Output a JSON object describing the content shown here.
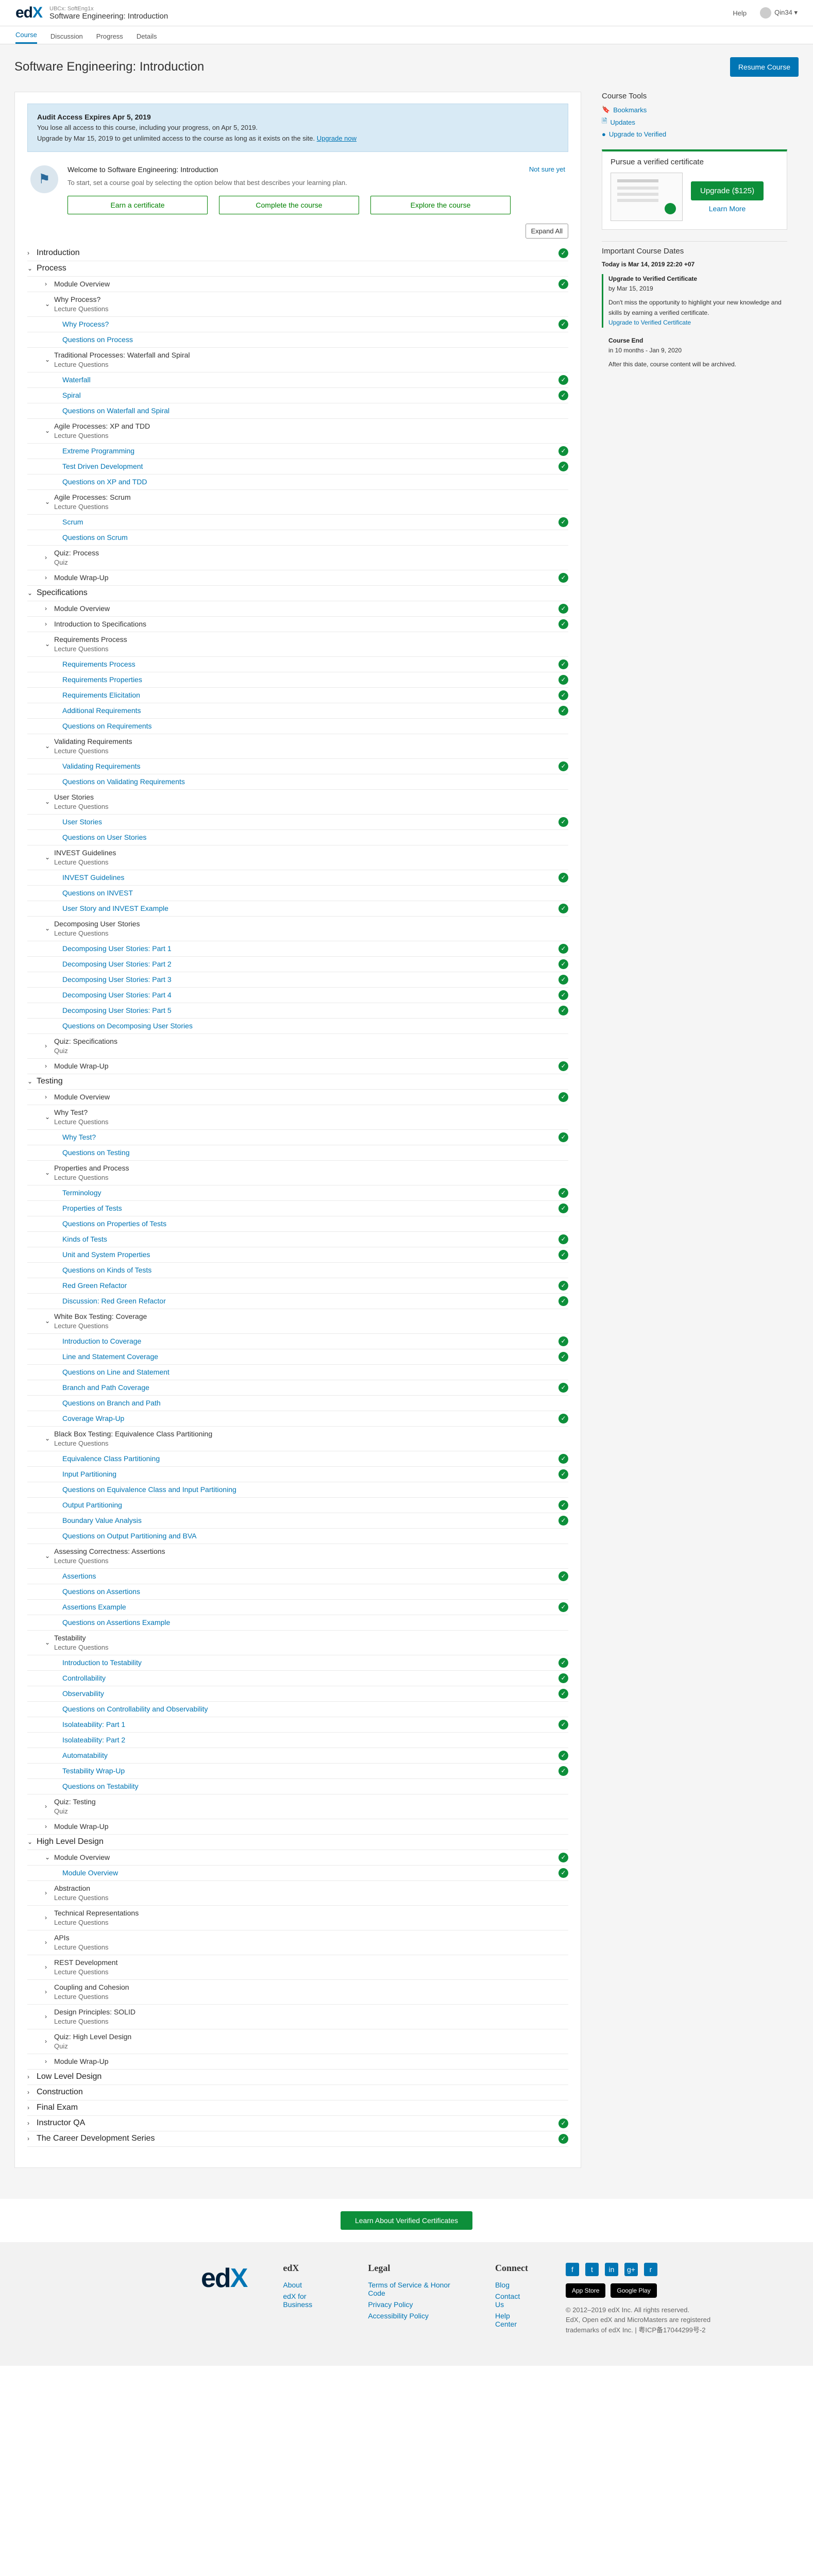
{
  "header": {
    "course_org": "UBCx: SoftEng1x",
    "course_name": "Software Engineering: Introduction",
    "help": "Help",
    "username": "Qin34",
    "user_caret": "▾"
  },
  "tabs": [
    {
      "label": "Course",
      "active": true
    },
    {
      "label": "Discussion",
      "active": false
    },
    {
      "label": "Progress",
      "active": false
    },
    {
      "label": "Details",
      "active": false
    }
  ],
  "page": {
    "title": "Software Engineering: Introduction",
    "resume": "Resume Course"
  },
  "alert": {
    "title": "Audit Access Expires Apr 5, 2019",
    "line1": "You lose all access to this course, including your progress, on Apr 5, 2019.",
    "line2": "Upgrade by Mar 15, 2019 to get unlimited access to the course as long as it exists on the site.",
    "link": "Upgrade now"
  },
  "welcome": {
    "title": "Welcome to Software Engineering: Introduction",
    "not_sure": "Not sure yet",
    "subtitle": "To start, set a course goal by selecting the option below that best describes your learning plan.",
    "goals": [
      "Earn a certificate",
      "Complete the course",
      "Explore the course"
    ]
  },
  "expand_all": "Expand All",
  "outline": [
    {
      "level": 0,
      "label": "Introduction",
      "open": false,
      "done": true
    },
    {
      "level": 0,
      "label": "Process",
      "open": true,
      "done": false
    },
    {
      "level": 1,
      "label": "Module Overview",
      "open": false,
      "done": true
    },
    {
      "level": 1,
      "label": "Why Process?",
      "sub": "Lecture Questions",
      "open": true,
      "done": false
    },
    {
      "level": 2,
      "label": "Why Process?",
      "done": true
    },
    {
      "level": 2,
      "label": "Questions on Process",
      "done": false
    },
    {
      "level": 1,
      "label": "Traditional Processes: Waterfall and Spiral",
      "sub": "Lecture Questions",
      "open": true,
      "done": false
    },
    {
      "level": 2,
      "label": "Waterfall",
      "done": true
    },
    {
      "level": 2,
      "label": "Spiral",
      "done": true
    },
    {
      "level": 2,
      "label": "Questions on Waterfall and Spiral",
      "done": false
    },
    {
      "level": 1,
      "label": "Agile Processes: XP and TDD",
      "sub": "Lecture Questions",
      "open": true,
      "done": false
    },
    {
      "level": 2,
      "label": "Extreme Programming",
      "done": true
    },
    {
      "level": 2,
      "label": "Test Driven Development",
      "done": true
    },
    {
      "level": 2,
      "label": "Questions on XP and TDD",
      "done": false
    },
    {
      "level": 1,
      "label": "Agile Processes: Scrum",
      "sub": "Lecture Questions",
      "open": true,
      "done": false
    },
    {
      "level": 2,
      "label": "Scrum",
      "done": true
    },
    {
      "level": 2,
      "label": "Questions on Scrum",
      "done": false
    },
    {
      "level": 1,
      "label": "Quiz: Process",
      "sub": "Quiz",
      "open": false,
      "done": false
    },
    {
      "level": 1,
      "label": "Module Wrap-Up",
      "open": false,
      "done": true
    },
    {
      "level": 0,
      "label": "Specifications",
      "open": true,
      "done": false
    },
    {
      "level": 1,
      "label": "Module Overview",
      "open": false,
      "done": true
    },
    {
      "level": 1,
      "label": "Introduction to Specifications",
      "open": false,
      "done": true
    },
    {
      "level": 1,
      "label": "Requirements Process",
      "sub": "Lecture Questions",
      "open": true,
      "done": false
    },
    {
      "level": 2,
      "label": "Requirements Process",
      "done": true
    },
    {
      "level": 2,
      "label": "Requirements Properties",
      "done": true
    },
    {
      "level": 2,
      "label": "Requirements Elicitation",
      "done": true
    },
    {
      "level": 2,
      "label": "Additional Requirements",
      "done": true
    },
    {
      "level": 2,
      "label": "Questions on Requirements",
      "done": false
    },
    {
      "level": 1,
      "label": "Validating Requirements",
      "sub": "Lecture Questions",
      "open": true,
      "done": false
    },
    {
      "level": 2,
      "label": "Validating Requirements",
      "done": true
    },
    {
      "level": 2,
      "label": "Questions on Validating Requirements",
      "done": false
    },
    {
      "level": 1,
      "label": "User Stories",
      "sub": "Lecture Questions",
      "open": true,
      "done": false
    },
    {
      "level": 2,
      "label": "User Stories",
      "done": true
    },
    {
      "level": 2,
      "label": "Questions on User Stories",
      "done": false
    },
    {
      "level": 1,
      "label": "INVEST Guidelines",
      "sub": "Lecture Questions",
      "open": true,
      "done": false
    },
    {
      "level": 2,
      "label": "INVEST Guidelines",
      "done": true
    },
    {
      "level": 2,
      "label": "Questions on INVEST",
      "done": false
    },
    {
      "level": 2,
      "label": "User Story and INVEST Example",
      "done": true
    },
    {
      "level": 1,
      "label": "Decomposing User Stories",
      "sub": "Lecture Questions",
      "open": true,
      "done": false
    },
    {
      "level": 2,
      "label": "Decomposing User Stories: Part 1",
      "done": true
    },
    {
      "level": 2,
      "label": "Decomposing User Stories: Part 2",
      "done": true
    },
    {
      "level": 2,
      "label": "Decomposing User Stories: Part 3",
      "done": true
    },
    {
      "level": 2,
      "label": "Decomposing User Stories: Part 4",
      "done": true
    },
    {
      "level": 2,
      "label": "Decomposing User Stories: Part 5",
      "done": true
    },
    {
      "level": 2,
      "label": "Questions on Decomposing User Stories",
      "done": false
    },
    {
      "level": 1,
      "label": "Quiz: Specifications",
      "sub": "Quiz",
      "open": false,
      "done": false
    },
    {
      "level": 1,
      "label": "Module Wrap-Up",
      "open": false,
      "done": true
    },
    {
      "level": 0,
      "label": "Testing",
      "open": true,
      "done": false
    },
    {
      "level": 1,
      "label": "Module Overview",
      "open": false,
      "done": true
    },
    {
      "level": 1,
      "label": "Why Test?",
      "sub": "Lecture Questions",
      "open": true,
      "done": false
    },
    {
      "level": 2,
      "label": "Why Test?",
      "done": true
    },
    {
      "level": 2,
      "label": "Questions on Testing",
      "done": false
    },
    {
      "level": 1,
      "label": "Properties and Process",
      "sub": "Lecture Questions",
      "open": true,
      "done": false
    },
    {
      "level": 2,
      "label": "Terminology",
      "done": true
    },
    {
      "level": 2,
      "label": "Properties of Tests",
      "done": true
    },
    {
      "level": 2,
      "label": "Questions on Properties of Tests",
      "done": false
    },
    {
      "level": 2,
      "label": "Kinds of Tests",
      "done": true
    },
    {
      "level": 2,
      "label": "Unit and System Properties",
      "done": true
    },
    {
      "level": 2,
      "label": "Questions on Kinds of Tests",
      "done": false
    },
    {
      "level": 2,
      "label": "Red Green Refactor",
      "done": true
    },
    {
      "level": 2,
      "label": "Discussion: Red Green Refactor",
      "done": true
    },
    {
      "level": 1,
      "label": "White Box Testing: Coverage",
      "sub": "Lecture Questions",
      "open": true,
      "done": false
    },
    {
      "level": 2,
      "label": "Introduction to Coverage",
      "done": true
    },
    {
      "level": 2,
      "label": "Line and Statement Coverage",
      "done": true
    },
    {
      "level": 2,
      "label": "Questions on Line and Statement",
      "done": false
    },
    {
      "level": 2,
      "label": "Branch and Path Coverage",
      "done": true
    },
    {
      "level": 2,
      "label": "Questions on Branch and Path",
      "done": false
    },
    {
      "level": 2,
      "label": "Coverage Wrap-Up",
      "done": true
    },
    {
      "level": 1,
      "label": "Black Box Testing: Equivalence Class Partitioning",
      "sub": "Lecture Questions",
      "open": true,
      "done": false
    },
    {
      "level": 2,
      "label": "Equivalence Class Partitioning",
      "done": true
    },
    {
      "level": 2,
      "label": "Input Partitioning",
      "done": true
    },
    {
      "level": 2,
      "label": "Questions on Equivalence Class and Input Partitioning",
      "done": false
    },
    {
      "level": 2,
      "label": "Output Partitioning",
      "done": true
    },
    {
      "level": 2,
      "label": "Boundary Value Analysis",
      "done": true
    },
    {
      "level": 2,
      "label": "Questions on Output Partitioning and BVA",
      "done": false
    },
    {
      "level": 1,
      "label": "Assessing Correctness: Assertions",
      "sub": "Lecture Questions",
      "open": true,
      "done": false
    },
    {
      "level": 2,
      "label": "Assertions",
      "done": true
    },
    {
      "level": 2,
      "label": "Questions on Assertions",
      "done": false
    },
    {
      "level": 2,
      "label": "Assertions Example",
      "done": true
    },
    {
      "level": 2,
      "label": "Questions on Assertions Example",
      "done": false
    },
    {
      "level": 1,
      "label": "Testability",
      "sub": "Lecture Questions",
      "open": true,
      "done": false
    },
    {
      "level": 2,
      "label": "Introduction to Testability",
      "done": true
    },
    {
      "level": 2,
      "label": "Controllability",
      "done": true
    },
    {
      "level": 2,
      "label": "Observability",
      "done": true
    },
    {
      "level": 2,
      "label": "Questions on Controllability and Observability",
      "done": false
    },
    {
      "level": 2,
      "label": "Isolateability: Part 1",
      "done": true
    },
    {
      "level": 2,
      "label": "Isolateability: Part 2",
      "done": false
    },
    {
      "level": 2,
      "label": "Automatability",
      "done": true
    },
    {
      "level": 2,
      "label": "Testability Wrap-Up",
      "done": true
    },
    {
      "level": 2,
      "label": "Questions on Testability",
      "done": false
    },
    {
      "level": 1,
      "label": "Quiz: Testing",
      "sub": "Quiz",
      "open": false,
      "done": false
    },
    {
      "level": 1,
      "label": "Module Wrap-Up",
      "open": false,
      "done": false
    },
    {
      "level": 0,
      "label": "High Level Design",
      "open": true,
      "done": false
    },
    {
      "level": 1,
      "label": "Module Overview",
      "open": true,
      "done": true
    },
    {
      "level": 2,
      "label": "Module Overview",
      "done": true
    },
    {
      "level": 1,
      "label": "Abstraction",
      "sub": "Lecture Questions",
      "open": false,
      "done": false
    },
    {
      "level": 1,
      "label": "Technical Representations",
      "sub": "Lecture Questions",
      "open": false,
      "done": false
    },
    {
      "level": 1,
      "label": "APIs",
      "sub": "Lecture Questions",
      "open": false,
      "done": false
    },
    {
      "level": 1,
      "label": "REST Development",
      "sub": "Lecture Questions",
      "open": false,
      "done": false
    },
    {
      "level": 1,
      "label": "Coupling and Cohesion",
      "sub": "Lecture Questions",
      "open": false,
      "done": false
    },
    {
      "level": 1,
      "label": "Design Principles: SOLID",
      "sub": "Lecture Questions",
      "open": false,
      "done": false
    },
    {
      "level": 1,
      "label": "Quiz: High Level Design",
      "sub": "Quiz",
      "open": false,
      "done": false
    },
    {
      "level": 1,
      "label": "Module Wrap-Up",
      "open": false,
      "done": false
    },
    {
      "level": 0,
      "label": "Low Level Design",
      "open": false,
      "done": false
    },
    {
      "level": 0,
      "label": "Construction",
      "open": false,
      "done": false
    },
    {
      "level": 0,
      "label": "Final Exam",
      "open": false,
      "done": false
    },
    {
      "level": 0,
      "label": "Instructor QA",
      "open": false,
      "done": true
    },
    {
      "level": 0,
      "label": "The Career Development Series",
      "open": false,
      "done": true
    }
  ],
  "sidebar": {
    "tools_title": "Course Tools",
    "tools": [
      {
        "icon": "bookmark-icon",
        "label": "Bookmarks"
      },
      {
        "icon": "updates-icon",
        "label": "Updates"
      },
      {
        "icon": "upgrade-icon",
        "label": "Upgrade to Verified"
      }
    ],
    "verified_title": "Pursue a verified certificate",
    "upgrade_btn": "Upgrade ($125)",
    "learn_more": "Learn More",
    "dates_title": "Important Course Dates",
    "today": "Today is Mar 14, 2019 22:20 +07",
    "entries": [
      {
        "head": "Upgrade to Verified Certificate",
        "date": "by Mar 15, 2019",
        "body": "Don't miss the opportunity to highlight your new knowledge and skills by earning a verified certificate.",
        "link": "Upgrade to Verified Certificate",
        "accent": true
      },
      {
        "head": "Course End",
        "date": "in 10 months - Jan 9, 2020",
        "body": "After this date, course content will be archived.",
        "link": "",
        "accent": false
      }
    ]
  },
  "footer": {
    "cta": "Learn About Verified Certificates",
    "col1_title": "edX",
    "col1": [
      "About",
      "edX for Business"
    ],
    "col2_title": "Legal",
    "col2": [
      "Terms of Service & Honor Code",
      "Privacy Policy",
      "Accessibility Policy"
    ],
    "col3_title": "Connect",
    "col3": [
      "Blog",
      "Contact Us",
      "Help Center"
    ],
    "social": [
      "f",
      "t",
      "in",
      "g+",
      "r"
    ],
    "stores": [
      "App Store",
      "Google Play"
    ],
    "copyright": "© 2012–2019 edX Inc. All rights reserved.",
    "copyright2": "EdX, Open edX and MicroMasters are registered trademarks of edX Inc. | 粤ICP备17044299号-2"
  },
  "colors": {
    "brand": "#0075b4",
    "success": "#0d8f3a",
    "logo": "#02203a"
  }
}
